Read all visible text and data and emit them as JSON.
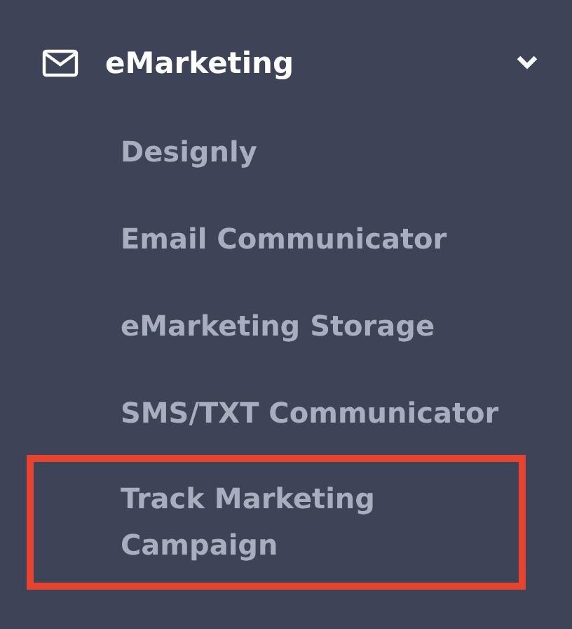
{
  "menu": {
    "label": "eMarketing",
    "expanded": true,
    "items": [
      {
        "label": "Designly",
        "highlighted": false
      },
      {
        "label": "Email Communicator",
        "highlighted": false
      },
      {
        "label": "eMarketing Storage",
        "highlighted": false
      },
      {
        "label": "SMS/TXT Communicator",
        "highlighted": false
      },
      {
        "label": "Track Marketing Campaign",
        "highlighted": true
      }
    ]
  }
}
